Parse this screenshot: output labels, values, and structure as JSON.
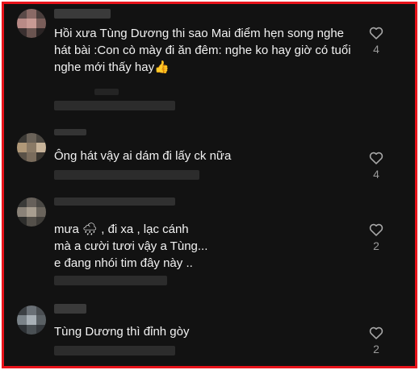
{
  "comments": [
    {
      "text": "Hồi xưa Tùng Dương thi sao Mai điểm hẹn song nghe hát bài :Con cò mày đi ăn đêm: nghe ko hay giờ có tuổi nghe mới thấy hay👍",
      "likes": "4"
    },
    {
      "text": "Ông hát vậy ai dám đi lấy ck nữa",
      "likes": "4"
    },
    {
      "text": "mưa 🌧 , đi xa , lạc cánh\nmà a cười tươi vậy a Tùng...\ne đang nhói tim đây này ..",
      "likes": "2"
    },
    {
      "text": "Tùng Dương thì đỉnh gòy",
      "likes": "2"
    }
  ],
  "icons": {
    "like": "heart-outline-icon"
  },
  "colors": {
    "border": "#e8141b",
    "background": "#121212",
    "text": "#f2f2f2",
    "muted": "#9a9a9a"
  }
}
